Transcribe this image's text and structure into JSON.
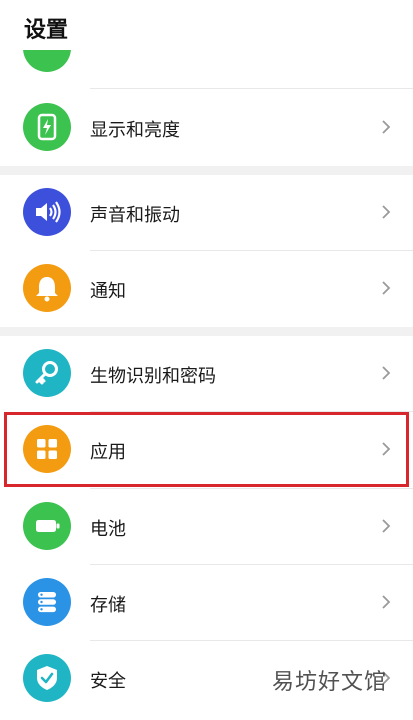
{
  "header": {
    "title": "设置"
  },
  "items": [
    {
      "label": "显示和亮度",
      "icon": "display-brightness-icon",
      "color": "#3cc24f"
    },
    {
      "label": "声音和振动",
      "icon": "speaker-icon",
      "color": "#3c50dc"
    },
    {
      "label": "通知",
      "icon": "bell-icon",
      "color": "#f39c12"
    },
    {
      "label": "生物识别和密码",
      "icon": "key-icon",
      "color": "#20b5c4"
    },
    {
      "label": "应用",
      "icon": "apps-grid-icon",
      "color": "#f39c12"
    },
    {
      "label": "电池",
      "icon": "battery-icon",
      "color": "#3cc24f"
    },
    {
      "label": "存储",
      "icon": "storage-icon",
      "color": "#2a93e6"
    },
    {
      "label": "安全",
      "icon": "shield-icon",
      "color": "#20b5c4"
    }
  ],
  "watermark": "易坊好文馆"
}
